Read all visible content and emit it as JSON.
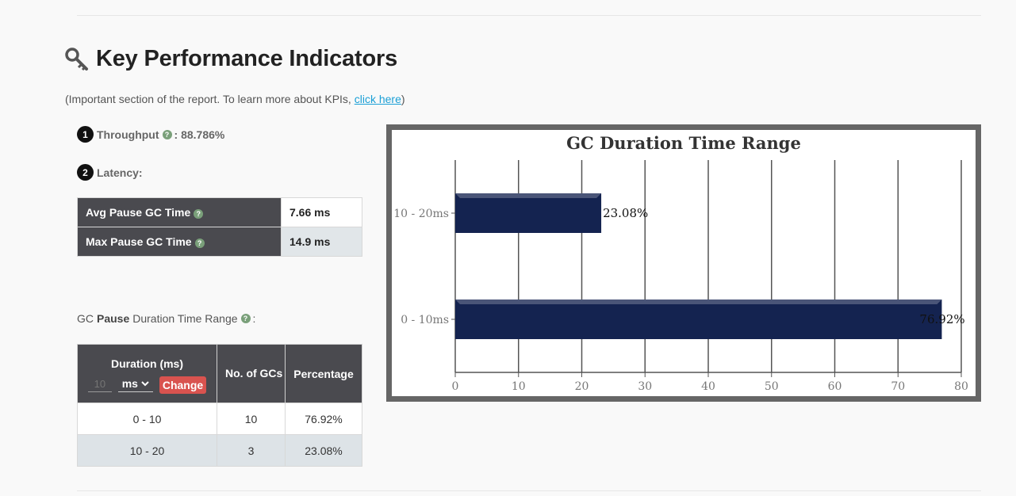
{
  "page": {
    "title": "Key Performance Indicators",
    "note_prefix": "(Important section of the report. To learn more about KPIs, ",
    "note_link": "click here",
    "note_suffix": ")"
  },
  "kpi": {
    "throughput_badge": "1",
    "throughput_label": "Throughput",
    "throughput_value": ": 88.786%",
    "latency_badge": "2",
    "latency_label": "Latency:",
    "help_glyph": "?"
  },
  "latency_table": {
    "rows": [
      {
        "label": "Avg Pause GC Time",
        "value": "7.66 ms"
      },
      {
        "label": "Max Pause GC Time",
        "value": "14.9 ms"
      }
    ]
  },
  "range_section": {
    "prefix": "GC",
    "bold": "Pause",
    "suffix": "Duration Time Range",
    "colon": ":"
  },
  "duration_table": {
    "header_duration": "Duration (ms)",
    "header_gcs": "No. of GCs",
    "header_pct": "Percentage",
    "input_placeholder": "10",
    "unit_selected": "ms",
    "change_label": "Change",
    "rows": [
      {
        "range": "0 - 10",
        "count": "10",
        "pct": "76.92%"
      },
      {
        "range": "10 - 20",
        "count": "3",
        "pct": "23.08%"
      }
    ]
  },
  "colors": {
    "bar": "#142350",
    "header_bg": "#4a4a4f",
    "change_btn": "#d9534f",
    "link": "#1a9fd6"
  },
  "chart_data": {
    "type": "bar",
    "orientation": "horizontal",
    "title": "GC Duration Time Range",
    "categories": [
      "0 - 10ms",
      "10 - 20ms"
    ],
    "values": [
      76.92,
      23.08
    ],
    "data_labels": [
      "76.92%",
      "23.08%"
    ],
    "xlim": [
      0,
      80
    ],
    "xticks": [
      0,
      10,
      20,
      30,
      40,
      50,
      60,
      70,
      80
    ],
    "grid": true,
    "legend": "none"
  }
}
